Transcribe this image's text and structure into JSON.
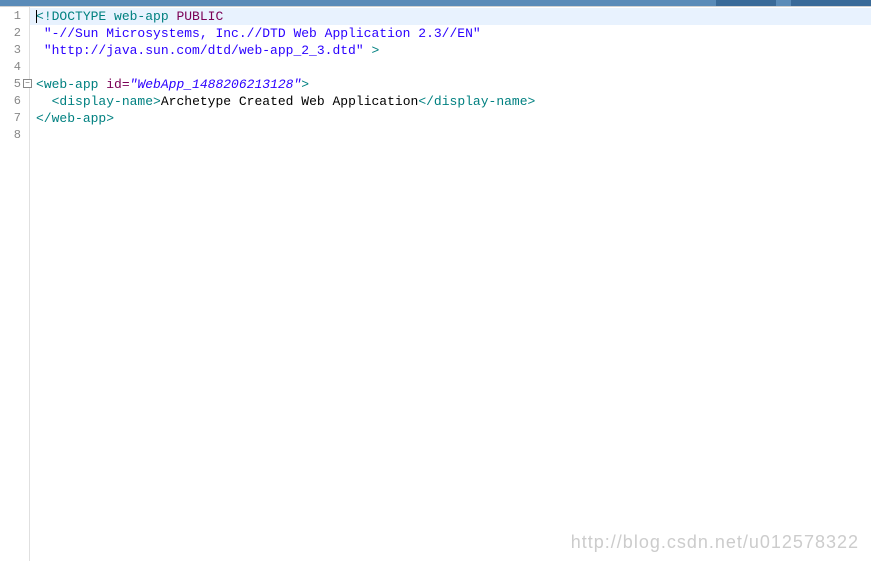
{
  "lines": {
    "count": 8,
    "foldable_line": 5
  },
  "code": {
    "line1": {
      "bracket_open": "<",
      "doctype": "!DOCTYPE web-app",
      "public": " PUBLIC"
    },
    "line2": {
      "str": "\"-//Sun Microsystems, Inc.//DTD Web Application 2.3//EN\""
    },
    "line3": {
      "str": "\"http://java.sun.com/dtd/web-app_2_3.dtd\"",
      "close": " >"
    },
    "line5": {
      "open": "<",
      "tag": "web-app",
      "attr": " id=",
      "value": "\"WebApp_1488206213128\"",
      "close": ">"
    },
    "line6": {
      "indent": "  ",
      "open1": "<",
      "tag1": "display-name",
      "close1": ">",
      "text": "Archetype Created Web Application",
      "open2": "</",
      "tag2": "display-name",
      "close2": ">"
    },
    "line7": {
      "open": "</",
      "tag": "web-app",
      "close": ">"
    }
  },
  "watermark": "http://blog.csdn.net/u012578322",
  "line_numbers": [
    "1",
    "2",
    "3",
    "4",
    "5",
    "6",
    "7",
    "8"
  ],
  "fold_symbol": "−"
}
